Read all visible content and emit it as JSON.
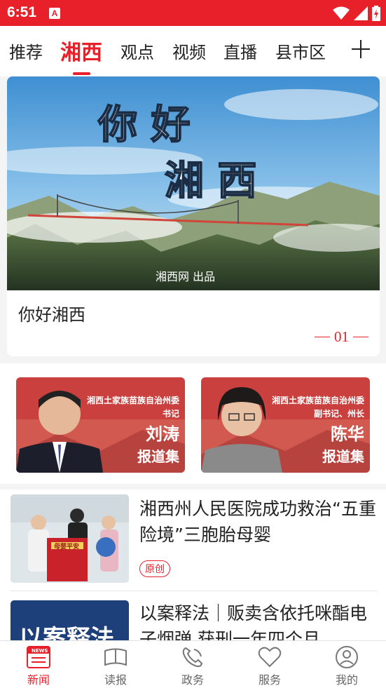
{
  "status_bar": {
    "time": "6:51",
    "app_icon_letter": "A"
  },
  "tabs": [
    {
      "label": "推荐",
      "active": false
    },
    {
      "label": "湘西",
      "active": true
    },
    {
      "label": "观点",
      "active": false
    },
    {
      "label": "视频",
      "active": false
    },
    {
      "label": "直播",
      "active": false
    },
    {
      "label": "县市区",
      "active": false
    }
  ],
  "banner": {
    "image_line1": "你 好",
    "image_line2": "湘 西",
    "image_credit": "湘西网 出品",
    "caption": "你好湘西",
    "page": "01"
  },
  "promos": [
    {
      "org_line1": "湘西土家族苗族自治州委",
      "org_line2": "书记",
      "name": "刘涛",
      "collection": "报道集"
    },
    {
      "org_line1": "湘西土家族苗族自治州委",
      "org_line2": "副书记、州长",
      "name": "陈华",
      "collection": "报道集"
    }
  ],
  "news": [
    {
      "title": "湘西州人民医院成功救治“五重险境”三胞胎母婴",
      "tag": "原创",
      "thumb_banner_text": "母婴平安"
    },
    {
      "title": "以案释法｜贩卖含依托咪酯电子烟弹 获刑一年四个月",
      "thumb_text": "以案释法"
    }
  ],
  "bottom_nav": [
    {
      "label": "新闻",
      "icon": "news-icon",
      "active": true
    },
    {
      "label": "读报",
      "icon": "newspaper-icon",
      "active": false
    },
    {
      "label": "政务",
      "icon": "government-icon",
      "active": false
    },
    {
      "label": "服务",
      "icon": "heart-icon",
      "active": false
    },
    {
      "label": "我的",
      "icon": "user-icon",
      "active": false
    }
  ],
  "colors": {
    "brand_red": "#e8202a"
  }
}
